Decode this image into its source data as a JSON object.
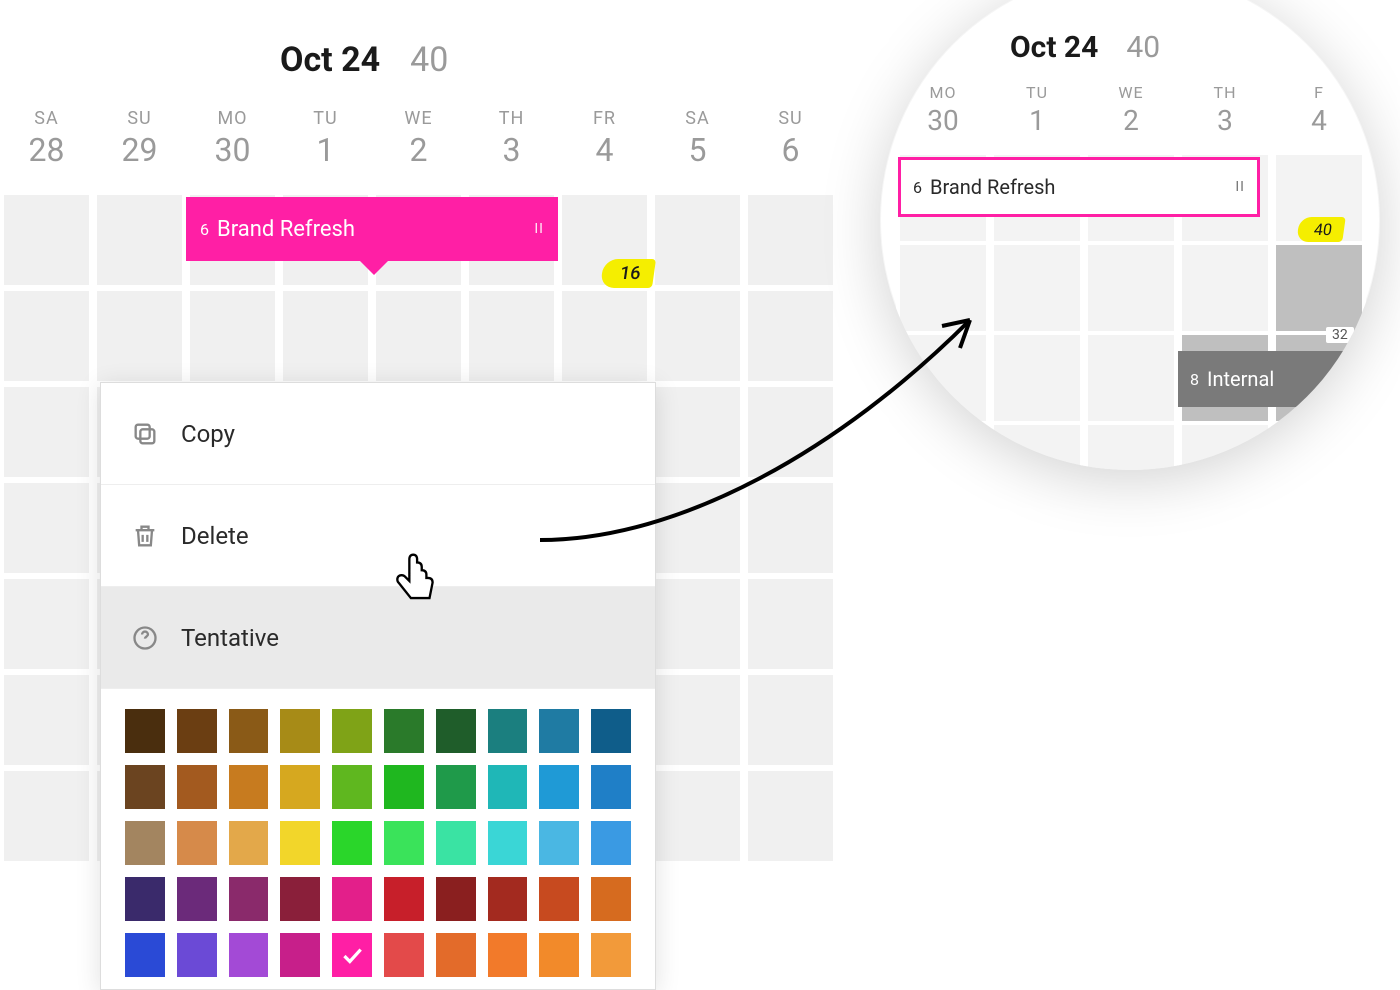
{
  "header": {
    "month": "Oct 24",
    "week": "40"
  },
  "days": [
    {
      "dow": "SA",
      "num": "28"
    },
    {
      "dow": "SU",
      "num": "29"
    },
    {
      "dow": "MO",
      "num": "30"
    },
    {
      "dow": "TU",
      "num": "1"
    },
    {
      "dow": "WE",
      "num": "2"
    },
    {
      "dow": "TH",
      "num": "3"
    },
    {
      "dow": "FR",
      "num": "4"
    },
    {
      "dow": "SA",
      "num": "5"
    },
    {
      "dow": "SU",
      "num": "6"
    }
  ],
  "event": {
    "id": "6",
    "title": "Brand Refresh",
    "handle": "II"
  },
  "badge": "16",
  "context_menu": {
    "copy": "Copy",
    "delete": "Delete",
    "tentative": "Tentative"
  },
  "palette": [
    [
      "#4a2e0e",
      "#6b3e12",
      "#8a5a17",
      "#a78b17",
      "#7fa317",
      "#2a7a2a",
      "#1f5d2a",
      "#1b7f7f",
      "#1f7ba3",
      "#0f5d8a"
    ],
    [
      "#6b4420",
      "#a35a1f",
      "#c77b1f",
      "#d6a81f",
      "#5fb71f",
      "#1fb71f",
      "#1f9a4a",
      "#1fb7b7",
      "#1f9ad6",
      "#1f7fc7"
    ],
    [
      "#a38560",
      "#d68a4a",
      "#e3a84a",
      "#f2d62a",
      "#2ad62a",
      "#3ae35a",
      "#3ae3a3",
      "#3ad6d6",
      "#4ab7e3",
      "#3a9ae3"
    ],
    [
      "#3a2a6b",
      "#6b2a7a",
      "#8a2a6b",
      "#8a1f3a",
      "#e31f8a",
      "#c71f2a",
      "#8a1f1f",
      "#a32a1f",
      "#c74a1f",
      "#d66b1f"
    ],
    [
      "#2a4ad6",
      "#6b4ad6",
      "#a34ad6",
      "#c71f8a",
      "#ff1fa5",
      "#e34a4a",
      "#e36b2a",
      "#f27a2a",
      "#f28a2a",
      "#f29a3a"
    ]
  ],
  "selected_swatch": {
    "row": 4,
    "col": 4
  },
  "magnifier": {
    "month": "Oct 24",
    "week": "40",
    "days": [
      {
        "dow": "MO",
        "num": "30"
      },
      {
        "dow": "TU",
        "num": "1"
      },
      {
        "dow": "WE",
        "num": "2"
      },
      {
        "dow": "TH",
        "num": "3"
      },
      {
        "dow": "F",
        "num": "4"
      }
    ],
    "event": {
      "id": "6",
      "title": "Brand Refresh",
      "handle": "II"
    },
    "badge": "40",
    "small_num": "32",
    "event2": {
      "id": "8",
      "title": "Internal"
    }
  }
}
